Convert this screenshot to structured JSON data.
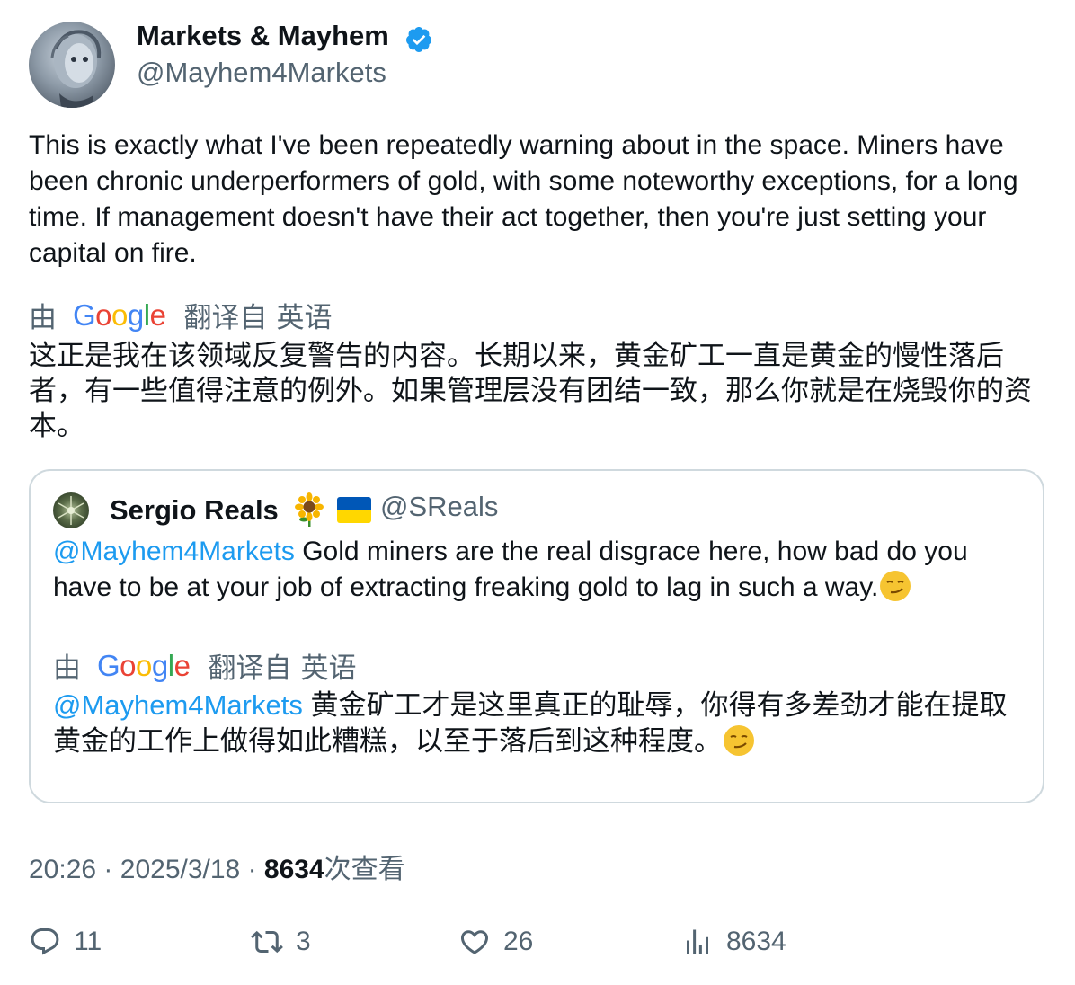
{
  "author": {
    "name": "Markets & Mayhem",
    "handle": "@Mayhem4Markets"
  },
  "tweet": {
    "text": "This is exactly what I've been repeatedly warning about in the space. Miners have been chronic underperformers of gold, with some noteworthy exceptions, for a long time. If management doesn't have their act together, then you're just setting your capital on fire.",
    "translation_label": {
      "by": "由",
      "provider": "Google",
      "from": "翻译自",
      "language": "英语"
    },
    "translated_text": "这正是我在该领域反复警告的内容。长期以来，黄金矿工一直是黄金的慢性落后者，有一些值得注意的例外。如果管理层没有团结一致，那么你就是在烧毁你的资本。"
  },
  "quote": {
    "name": "Sergio Reals",
    "handle": "@SReals",
    "mention": "@Mayhem4Markets",
    "text": "Gold miners are the real disgrace here, how bad do you have to be at your job of extracting freaking gold to lag in such a way.",
    "translation_label": {
      "by": "由",
      "provider": "Google",
      "from": "翻译自",
      "language": "英语"
    },
    "translated_mention": "@Mayhem4Markets",
    "translated_text": "黄金矿工才是这里真正的耻辱，你得有多差劲才能在提取黄金的工作上做得如此糟糕，以至于落后到这种程度。"
  },
  "meta": {
    "time": "20:26",
    "separator": "·",
    "date": "2025/3/18",
    "views_count": "8634",
    "views_label": "次查看"
  },
  "actions": {
    "replies": "11",
    "retweets": "3",
    "likes": "26",
    "views": "8634"
  },
  "colors": {
    "text": "#0f1419",
    "secondary": "#536471",
    "link": "#1d9bf0",
    "verified": "#1d9bf0",
    "border": "#cfd9de"
  },
  "icons": {
    "verified": "verified-badge-icon",
    "reply": "reply-icon",
    "retweet": "retweet-icon",
    "like": "heart-icon",
    "views": "views-icon"
  }
}
